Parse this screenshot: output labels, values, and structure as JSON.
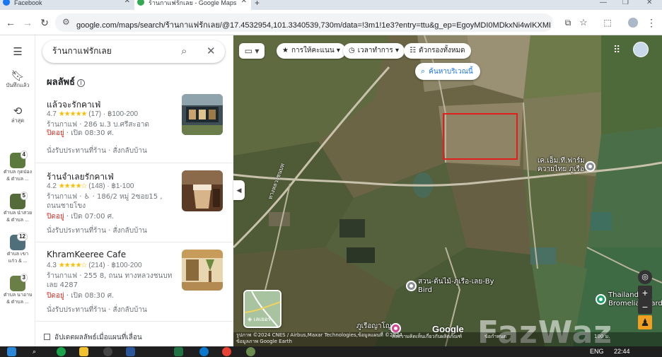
{
  "browser": {
    "tabs": [
      {
        "title": "Facebook",
        "favicon_color": "#1877f2"
      },
      {
        "title": "ร้านกาแฟรักเลย - Google Maps",
        "favicon_color": "#34a853"
      }
    ],
    "new_tab_icon": "plus-icon",
    "url": "google.com/maps/search/ร้านกาแฟรักเลย/@17.4532954,101.3340539,730m/data=!3m1!1e3?entry=ttu&g_ep=EgoyMDI0MDkxNi4wIKXMDSoASAFQAw%3D%3D"
  },
  "rail": {
    "menu_icon": "hamburger-icon",
    "items": [
      {
        "icon": "bookmark-icon",
        "label": "บันทึกแล้ว"
      },
      {
        "icon": "history-icon",
        "label": "ล่าสุด"
      }
    ],
    "recents": [
      {
        "badge": "4",
        "caption1": "ตำบล กุดป่อง",
        "caption2": "& ตำบล ...",
        "color": "#5c7a3e"
      },
      {
        "badge": "5",
        "caption1": "ตำบล น้ำสวย",
        "caption2": "& ตำบล ...",
        "color": "#556b3a"
      },
      {
        "badge": "12",
        "caption1": "ตำบล เขา",
        "caption2": "แก้ว & ...",
        "color": "#4f6f7a"
      },
      {
        "badge": "3",
        "caption1": "ตำบล นาอาน",
        "caption2": "& ตำบล ...",
        "color": "#6a7f45"
      }
    ]
  },
  "search": {
    "query": "ร้านกาแฟรักเลย",
    "search_icon": "search-icon",
    "close_icon": "close-icon"
  },
  "results": {
    "heading": "ผลลัพธ์",
    "items": [
      {
        "name": "แล้วจะรักคาเฟ่",
        "rating": "4.7",
        "stars": "★★★★★",
        "reviews": "(17)",
        "price": "฿100-200",
        "meta": "ร้านกาแฟ · 286 ม.3 บ.ศรีสะอาด",
        "status": "ปิดอยู่",
        "hours": "· เปิด 08:30 ศ.",
        "services": "นั่งรับประทานที่ร้าน · สั่งกลับบ้าน",
        "photo_color": "#4b5a62"
      },
      {
        "name": "ร้านจำเลยรักคาเฟ่",
        "rating": "4.2",
        "stars": "★★★★☆",
        "reviews": "(148)",
        "price": "฿1-100",
        "meta": "ร้านกาแฟ · ♿ · 186/2 หมู่ 2ซอย15 , ถนนชายโขง",
        "status": "ปิดอยู่",
        "hours": "· เปิด 07:00 ศ.",
        "services": "นั่งรับประทานที่ร้าน · สั่งกลับบ้าน",
        "photo_color": "#7a5638"
      },
      {
        "name": "KhramKeeree Cafe",
        "rating": "4.3",
        "stars": "★★★★☆",
        "reviews": "(214)",
        "price": "฿100-200",
        "meta": "ร้านกาแฟ · 255 8, ถนน ทางหลวงชนบท เลย 4287",
        "status": "ปิดอยู่",
        "hours": "· เปิด 08:30 ศ.",
        "services": "นั่งรับประทานที่ร้าน · สั่งกลับบ้าน",
        "photo_color": "#b98a4a"
      }
    ],
    "update_checkbox": "อัปเดตผลลัพธ์เมื่อแผนที่เลื่อน"
  },
  "map": {
    "filters": [
      {
        "icon": "star-icon",
        "label": "การให้คะแนน"
      },
      {
        "icon": "clock-icon",
        "label": "เวลาทำการ"
      },
      {
        "icon": "filter-icon",
        "label": "ตัวกรองทั้งหมด"
      }
    ],
    "search_area": "ค้นหาบริเวณนี้",
    "places": [
      {
        "label1": "เค.เอ็ม.ที.ฟาร์ม",
        "label2": "ควายไทย ภูเรือ"
      },
      {
        "label1": "สวน-ต้นไม้-ภูเรือ-เลย-By",
        "label2": "Bird"
      },
      {
        "label1": "Thailand",
        "label2": "Bromeliad garde"
      },
      {
        "label1": "ภูเรือญาโญ",
        "label2": ""
      }
    ],
    "road_label": "ทางหลวงชนบท",
    "layers_label": "เลเยอร์",
    "google_logo": "Google",
    "attribution": "รูปภาพ ©2024 CNES / Airbus,Maxar Technologies,ข้อมูลแผนที่ ©2024",
    "attribution2": "ข้อมูลภาพ Google Earth",
    "terms": "ข้อกำหนด",
    "privacy": "ส่งความคิดเห็นเกี่ยวกับผลิตภัณฑ์",
    "scale": "100 ม.",
    "watermark": "FazWaz"
  },
  "taskbar": {
    "time": "22:44",
    "lang": "ENG"
  }
}
